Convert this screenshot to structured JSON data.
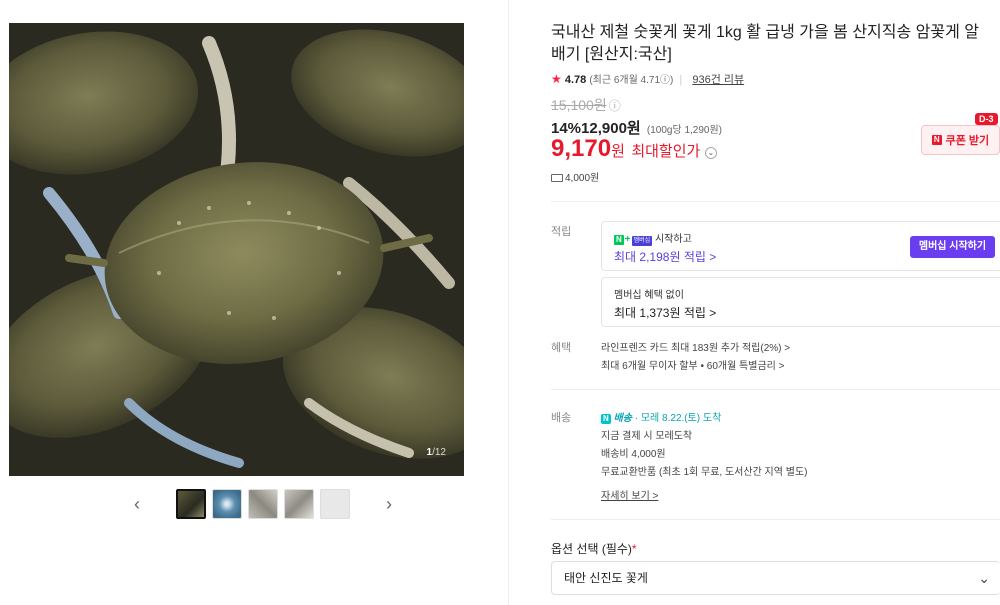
{
  "gallery": {
    "page_current": "1",
    "page_total": "/12",
    "prev_icon": "chevron-left-icon",
    "next_icon": "chevron-right-icon",
    "thumbnails": 5
  },
  "product": {
    "title": "국내산 제철 숫꽃게 꽃게 1kg 활 급냉 가을 봄 산지직송 암꽃게 알배기 [원산지:국산]",
    "rating": "4.78",
    "recent_rating": "(최근 6개월 4.71ⓘ)",
    "review_count": "936건 리뷰",
    "original_price": "15,100원",
    "discount_rate": "14%",
    "sale_price": "12,900원",
    "unit_price": "(100g당 1,290원)",
    "max_discount_price": "9,170",
    "max_discount_won": "원",
    "max_discount_label": "최대할인가",
    "shipping_fee": "4,000원",
    "coupon_label": "쿠폰 받기",
    "coupon_dday": "D-3"
  },
  "points": {
    "label": "적립",
    "member_start_text": "시작하고",
    "member_max": "최대 2,198원 적립 >",
    "member_button": "멤버십 시작하기",
    "no_member_text": "멤버십 혜택 없이",
    "no_member_max": "최대 1,373원 적립 >"
  },
  "benefits": {
    "label": "혜택",
    "line1": "라인프렌즈 카드 최대 183원 추가 적립(2%) >",
    "line2": "최대 6개월 무이자 할부 • 60개월 특별금리 >"
  },
  "delivery": {
    "label": "배송",
    "badge": "배송",
    "date": "· 모레 8.22.(토) 도착",
    "line2": "지금 결제 시 모레도착",
    "line3": "배송비 4,000원",
    "line4": "무료교환반품 (최초 1회 무료, 도서산간 지역 별도)",
    "detail_link": "자세히 보기 >"
  },
  "option": {
    "label": "옵션 선택 (필수)",
    "required_mark": "*",
    "selected": "태안 신진도 꽃게"
  },
  "colors": {
    "accent_red": "#e8192c",
    "member_purple": "#6a3df0",
    "naver_green": "#03c75a",
    "delivery_teal": "#0aa3b4"
  }
}
